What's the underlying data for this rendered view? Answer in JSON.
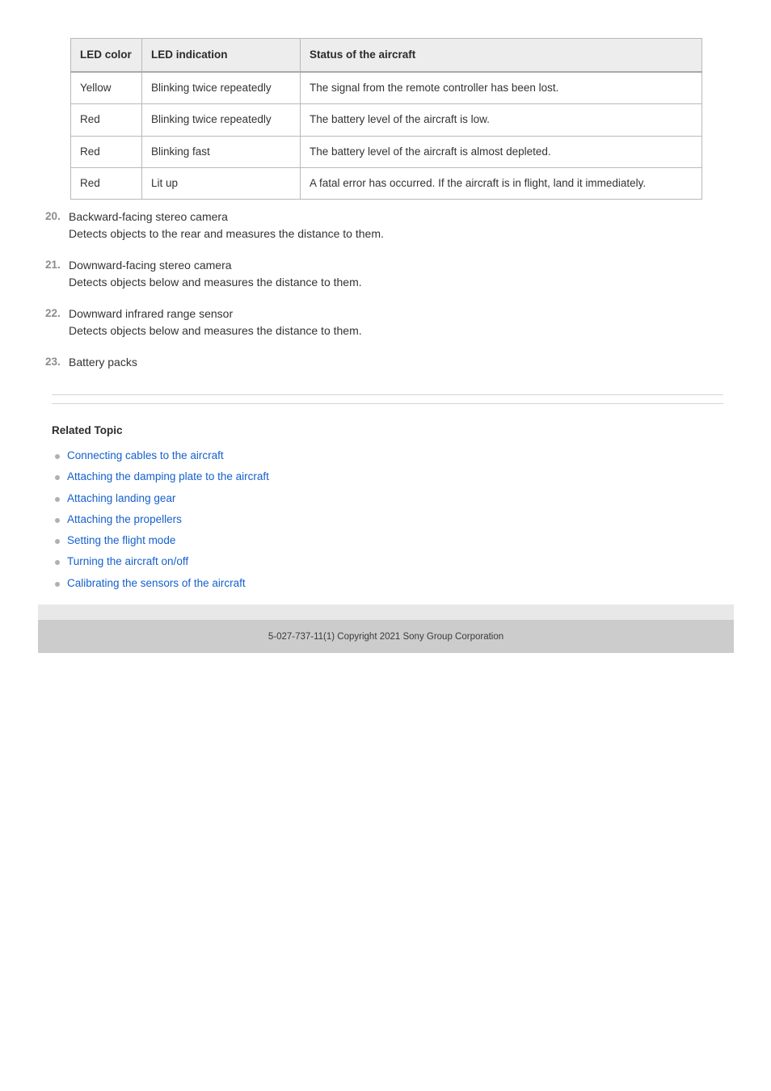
{
  "led_table": {
    "headers": [
      "LED color",
      "LED indication",
      "Status of the aircraft"
    ],
    "rows": [
      {
        "color": "Yellow",
        "indication": "Blinking twice repeatedly",
        "status": "The signal from the remote controller has been lost."
      },
      {
        "color": "Red",
        "indication": "Blinking twice repeatedly",
        "status": "The battery level of the aircraft is low."
      },
      {
        "color": "Red",
        "indication": "Blinking fast",
        "status": "The battery level of the aircraft is almost depleted."
      },
      {
        "color": "Red",
        "indication": "Lit up",
        "status": "A fatal error has occurred. If the aircraft is in flight, land it immediately."
      }
    ]
  },
  "numbered_items": [
    {
      "number": "20.",
      "title": "Backward-facing stereo camera",
      "description": "Detects objects to the rear and measures the distance to them."
    },
    {
      "number": "21.",
      "title": "Downward-facing stereo camera",
      "description": "Detects objects below and measures the distance to them."
    },
    {
      "number": "22.",
      "title": "Downward infrared range sensor",
      "description": "Detects objects below and measures the distance to them."
    },
    {
      "number": "23.",
      "title": "Battery packs",
      "description": ""
    }
  ],
  "related": {
    "heading": "Related Topic",
    "links": [
      "Connecting cables to the aircraft",
      "Attaching the damping plate to the aircraft",
      "Attaching landing gear",
      "Attaching the propellers",
      "Setting the flight mode",
      "Turning the aircraft on/off",
      "Calibrating the sensors of the aircraft"
    ]
  },
  "footer": {
    "copyright": "5-027-737-11(1) Copyright 2021 Sony Group Corporation"
  },
  "colors": {
    "link": "#1560cd",
    "table_header_bg": "#ededed",
    "table_border": "#b9b9b9",
    "footer_light": "#e8e8e8",
    "footer_dark": "#cccccc",
    "number_marker": "#8c8c8c",
    "text": "#333333"
  }
}
